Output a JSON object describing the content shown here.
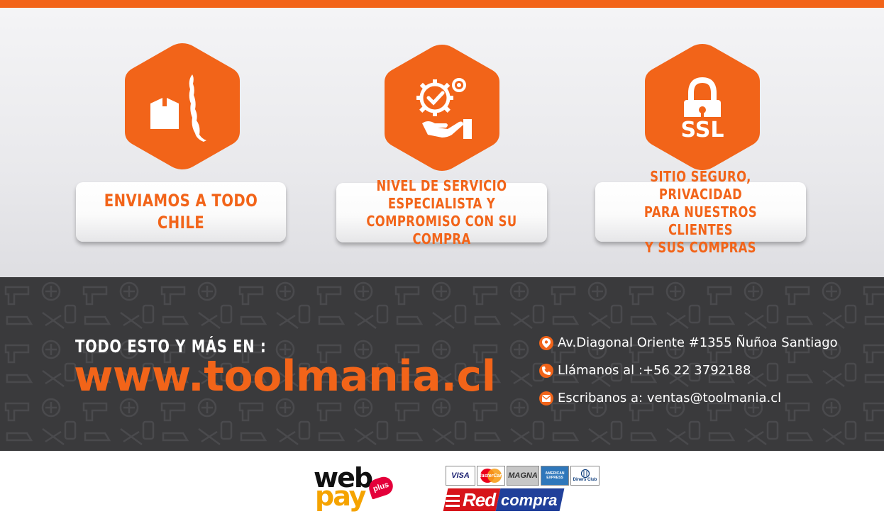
{
  "colors": {
    "accent": "#f26419",
    "dark_band": "#3a3a3c",
    "text_light": "#ffffff"
  },
  "features": [
    {
      "icon": "chile-box-icon",
      "label": "ENVIAMOS A TODO\nCHILE"
    },
    {
      "icon": "service-gear-hand-icon",
      "label": "NIVEL DE SERVICIO\nESPECIALISTA Y\nCOMPROMISO CON SU COMPRA"
    },
    {
      "icon": "ssl-lock-icon",
      "icon_text": "SSL",
      "label": "SITIO SEGURO, PRIVACIDAD\nPARA NUESTROS CLIENTES\nY SUS COMPRAS"
    }
  ],
  "promo": {
    "tagline": "TODO ESTO Y MÁS EN :",
    "website": "www.toolmania.cl"
  },
  "contact": [
    {
      "icon": "location-pin-icon",
      "text": "Av.Diagonal Oriente #1355 Ñuñoa Santiago"
    },
    {
      "icon": "phone-icon",
      "text": "Llámanos al :+56 22 3792188"
    },
    {
      "icon": "email-icon",
      "text": "Escribanos a: ventas@toolmania.cl"
    }
  ],
  "payments": {
    "webpay": {
      "word1": "web",
      "word2": "pay",
      "badge": "plus"
    },
    "cards": [
      "VISA",
      "MasterCard",
      "MAGNA",
      "AMERICAN EXPRESS",
      "Diners Club"
    ],
    "redcompra": {
      "word1": "Red",
      "word2": "compra"
    }
  }
}
